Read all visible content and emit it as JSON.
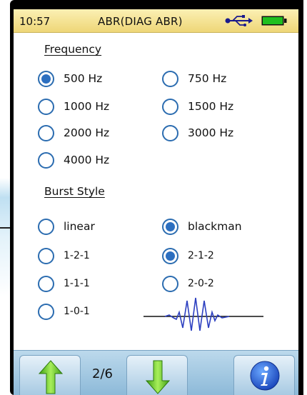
{
  "status": {
    "time": "10:57",
    "title": "ABR(DIAG ABR)",
    "usb_icon": "usb-icon",
    "battery_icon": "battery-icon",
    "battery_color": "#1fbf1f"
  },
  "frequency": {
    "heading": "Frequency",
    "options": [
      {
        "label": "500 Hz",
        "selected": true
      },
      {
        "label": "750 Hz",
        "selected": false
      },
      {
        "label": "1000 Hz",
        "selected": false
      },
      {
        "label": "1500 Hz",
        "selected": false
      },
      {
        "label": "2000 Hz",
        "selected": false
      },
      {
        "label": "3000 Hz",
        "selected": false
      },
      {
        "label": "4000 Hz",
        "selected": false
      }
    ]
  },
  "burst": {
    "heading": "Burst Style",
    "options": [
      {
        "label": "linear",
        "selected": false
      },
      {
        "label": "blackman",
        "selected": true
      },
      {
        "label": "1-2-1",
        "selected": false
      },
      {
        "label": "2-1-2",
        "selected": true
      },
      {
        "label": "1-1-1",
        "selected": false
      },
      {
        "label": "2-0-2",
        "selected": false
      },
      {
        "label": "1-0-1",
        "selected": false
      }
    ],
    "waveform_icon": "waveform-icon"
  },
  "toolbar": {
    "up_icon": "arrow-up-icon",
    "page": "2/6",
    "down_icon": "arrow-down-icon",
    "info_icon": "info-icon"
  },
  "colors": {
    "accent": "#2c6fc0",
    "status_bg": "#f3e39a",
    "toolbar_bg": "#a9cde6",
    "arrow_green": "#5cc21f"
  }
}
